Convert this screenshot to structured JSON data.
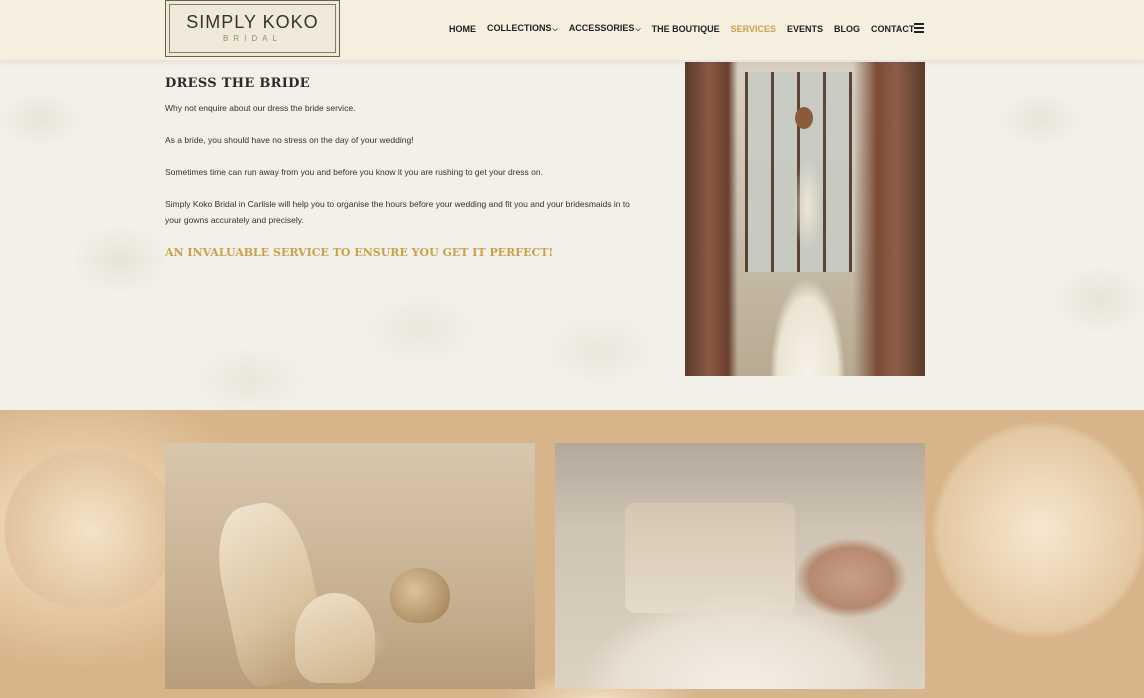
{
  "header": {
    "logo": {
      "main": "SIMPLY KOKO",
      "sub": "BRIDAL"
    },
    "nav": [
      {
        "label": "HOME",
        "has_dropdown": false,
        "active": false
      },
      {
        "label": "COLLECTIONS",
        "has_dropdown": true,
        "active": false
      },
      {
        "label": "ACCESSORIES",
        "has_dropdown": true,
        "active": false
      },
      {
        "label": "THE BOUTIQUE",
        "has_dropdown": false,
        "active": false
      },
      {
        "label": "SERVICES",
        "has_dropdown": false,
        "active": true
      },
      {
        "label": "EVENTS",
        "has_dropdown": false,
        "active": false
      },
      {
        "label": "BLOG",
        "has_dropdown": false,
        "active": false
      },
      {
        "label": "CONTACT",
        "has_dropdown": false,
        "active": false
      }
    ],
    "menu_icon": "hamburger-menu-icon"
  },
  "content": {
    "title": "DRESS THE BRIDE",
    "paragraphs": [
      "Why not enquire about our dress the bride service.",
      "As a bride, you should have no stress on the day of your wedding!",
      "Sometimes time can run away from you and before you know it you are rushing to get your dress on.",
      "Simply Koko Bridal in Carlisle will help you to organise the hours before your wedding and fit you and your bridesmaids in to your gowns accurately and precisely."
    ],
    "tagline": "AN INVALUABLE SERVICE TO ENSURE YOU GET IT PERFECT!"
  },
  "colors": {
    "accent": "#c9a24e",
    "text": "#333333",
    "header_bg": "#f5eede"
  }
}
